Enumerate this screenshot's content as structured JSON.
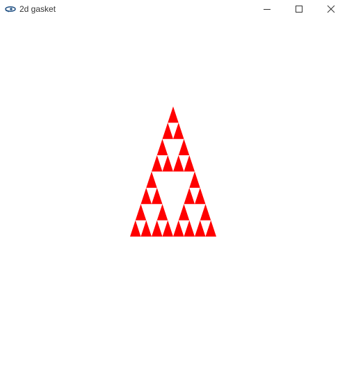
{
  "window": {
    "title": "2d gasket",
    "app_icon": "opengl-app-icon",
    "controls": {
      "minimize_icon": "minimize-icon",
      "maximize_icon": "maximize-icon",
      "close_icon": "close-icon"
    }
  },
  "canvas": {
    "background": "#ffffff",
    "fill_color": "#ff0000",
    "figure": "sierpinski-gasket",
    "subdivision_depth": 3
  }
}
